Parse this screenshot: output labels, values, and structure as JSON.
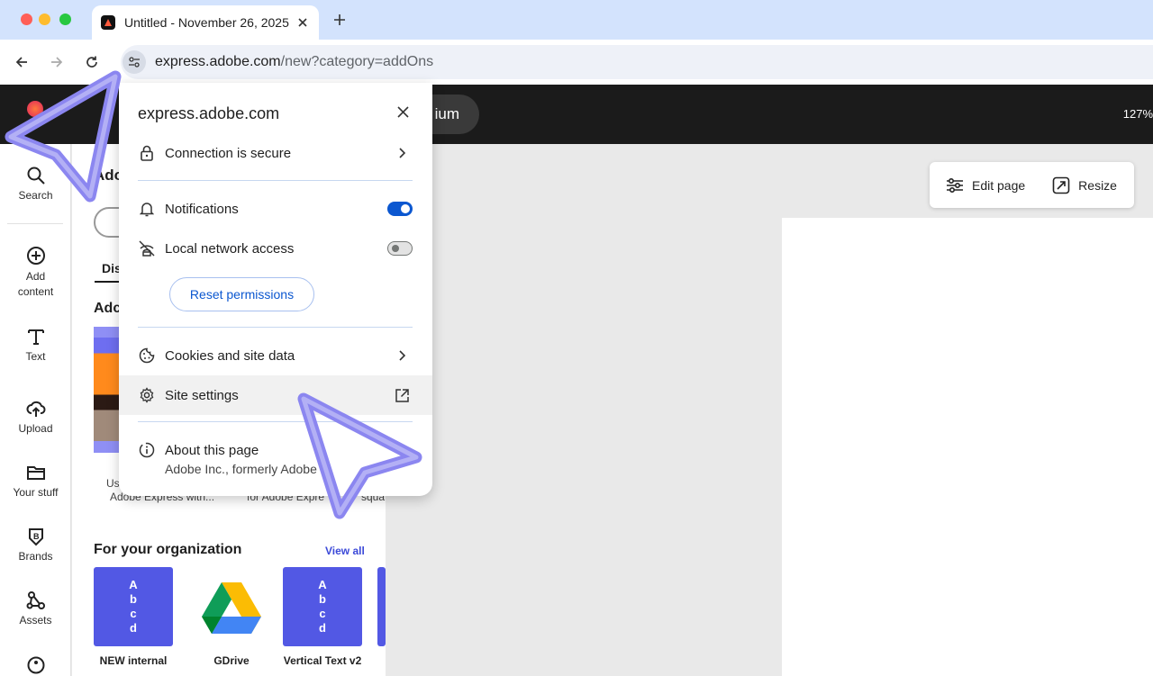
{
  "browser": {
    "tab_title": "Untitled - November 26, 2025",
    "url_host": "express.adobe.com",
    "url_path": "/new?category=addOns"
  },
  "app": {
    "premium_label": "ium",
    "zoom_label": "127%",
    "rail": [
      {
        "label": "Search"
      },
      {
        "label": "Add content"
      },
      {
        "label": "Text"
      },
      {
        "label": "Upload"
      },
      {
        "label": "Your stuff"
      },
      {
        "label": "Brands"
      },
      {
        "label": "Assets"
      }
    ],
    "panel": {
      "heading_fragment": "Ado",
      "tab_fragment": "Dis",
      "section1_fragment": "Adc",
      "caption_a": "Us",
      "caption_b": "Adobe Express with...",
      "caption_c": "for Adobe Expre",
      "caption_d": "squa",
      "section2": "For your organization",
      "view_all": "View all",
      "cards": [
        {
          "caption": "NEW internal listing TEST",
          "letters": [
            "A",
            "b",
            "c",
            "d"
          ]
        },
        {
          "caption": "GDrive screenshot"
        },
        {
          "caption": "Vertical Text v2",
          "letters": [
            "A",
            "b",
            "c",
            "d"
          ]
        }
      ]
    },
    "page_toolbar": {
      "edit_page": "Edit page",
      "resize": "Resize"
    }
  },
  "popup": {
    "title": "express.adobe.com",
    "connection": "Connection is secure",
    "notifications": "Notifications",
    "notifications_on": true,
    "local_network": "Local network access",
    "local_network_on": false,
    "reset": "Reset permissions",
    "cookies": "Cookies and site data",
    "site_settings": "Site settings",
    "about": "About this page",
    "about_sub": "Adobe Inc., formerly Adobe"
  },
  "colors": {
    "accent_blue": "#0b57d0",
    "cursor_purple": "#8b86f0",
    "card_purple": "#5258e4"
  }
}
